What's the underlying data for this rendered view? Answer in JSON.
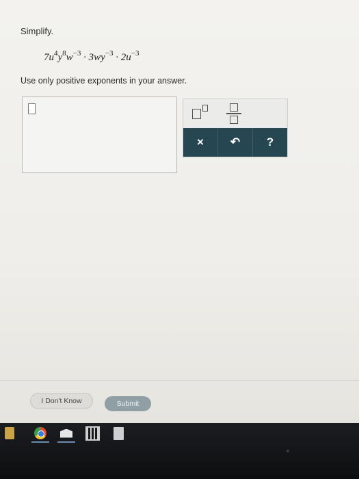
{
  "question": {
    "prompt": "Simplify.",
    "expression": {
      "t1_coef": "7u",
      "t1_u_exp": "4",
      "t1_y": "y",
      "t1_y_exp": "8",
      "t1_w": "w",
      "t1_w_exp": "−3",
      "t2_coef": "3wy",
      "t2_y_exp": "−3",
      "t3_coef": "2u",
      "t3_u_exp": "−3",
      "dot": "·"
    },
    "instruction": "Use only positive exponents in your answer."
  },
  "palette": {
    "clear_label": "×",
    "undo_label": "↶",
    "help_label": "?"
  },
  "footer": {
    "dont_know_label": "I Don't Know",
    "submit_label": "Submit"
  },
  "taskbar": {
    "icons": [
      "app-icon",
      "chrome-icon",
      "mail-icon",
      "calendar-icon",
      "calculator-icon"
    ]
  }
}
